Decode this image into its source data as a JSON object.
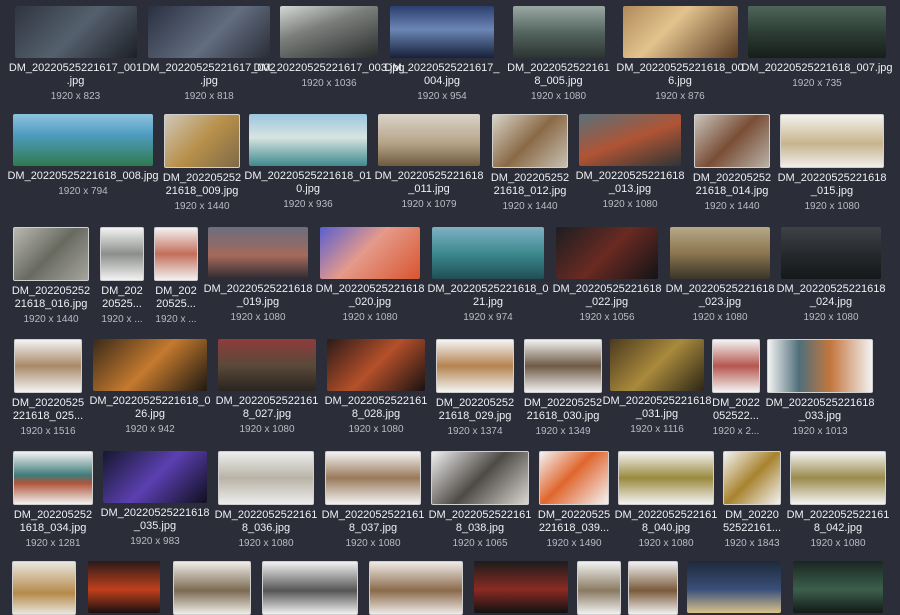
{
  "gallery": {
    "rows": [
      [
        {
          "name": "DM_20220525221617_001\n.jpg",
          "dims": "1920 x 823",
          "bg": "linear-gradient(135deg,#2f3540,#55606e 50%,#1d2026)"
        },
        {
          "name": "DM_20220525221617_002\n.jpg",
          "dims": "1920 x 818",
          "bg": "linear-gradient(135deg,#2a3040,#626d80 55%,#2a2d36)"
        },
        {
          "name": "DM_20220525221617_003.jpg",
          "dims": "1920 x 1036",
          "bg": "linear-gradient(160deg,#d6d8d6,#7a7d7a 40%,#2a2c2c)"
        },
        {
          "name": "DM_20220525221617_\n004.jpg",
          "dims": "1920 x 954",
          "bg": "linear-gradient(180deg,#2c3f6e,#6b86b6 45%,#16203a)"
        },
        {
          "name": "DM_2022052522161\n8_005.jpg",
          "dims": "1920 x 1080",
          "bg": "linear-gradient(180deg,#9aa9a4,#55655f 50%,#2b3431)"
        },
        {
          "name": "DM_20220525221618_00\n6.jpg",
          "dims": "1920 x 876",
          "bg": "linear-gradient(135deg,#b08a5a,#e2c38d 40%,#5a3a22)"
        },
        {
          "name": "DM_20220525221618_007.jpg",
          "dims": "1920 x 735",
          "bg": "linear-gradient(180deg,#4f6559,#2a3a32 55%,#171e1a)"
        }
      ],
      [
        {
          "name": "DM_20220525221618_008.jpg",
          "dims": "1920 x 794",
          "bg": "linear-gradient(180deg,#8ec3de,#4f9cc0 40%,#2f7a4e)"
        },
        {
          "name": "DM_202205252\n21618_009.jpg",
          "dims": "1920 x 1440",
          "bg": "linear-gradient(135deg,#cfc7b9,#b8904a 50%,#7e6a48)"
        },
        {
          "name": "DM_20220525221618_01\n0.jpg",
          "dims": "1920 x 936",
          "bg": "linear-gradient(180deg,#9cc6de,#d7e4e0 45%,#3f8a8e)"
        },
        {
          "name": "DM_20220525221618\n_011.jpg",
          "dims": "1920 x 1079",
          "bg": "linear-gradient(180deg,#d9d4c9,#b7a58a 55%,#6f5a3f)"
        },
        {
          "name": "DM_202205252\n21618_012.jpg",
          "dims": "1920 x 1440",
          "bg": "linear-gradient(135deg,#d7d2c7,#8a6a46 50%,#c7c0b2)"
        },
        {
          "name": "DM_20220525221618\n_013.jpg",
          "dims": "1920 x 1080",
          "bg": "linear-gradient(160deg,#59707a,#b05434 50%,#2d3536)"
        },
        {
          "name": "DM_202205252\n21618_014.jpg",
          "dims": "1920 x 1440",
          "bg": "linear-gradient(135deg,#c8c4bc,#7a4e36 50%,#b9b3a8)"
        },
        {
          "name": "DM_20220525221618\n_015.jpg",
          "dims": "1920 x 1080",
          "bg": "linear-gradient(180deg,#f4f2ee,#c7b48c 55%,#f0eeea)"
        }
      ],
      [
        {
          "name": "DM_202205252\n21618_016.jpg",
          "dims": "1920 x 1440",
          "bg": "linear-gradient(135deg,#b9b8b2,#686a60 50%,#a6a59e)"
        },
        {
          "name": "DM_202\n20525...",
          "dims": "1920 x ...",
          "bg": "linear-gradient(180deg,#f2f2f2,#8b8f8a 50%,#f2f2f2)"
        },
        {
          "name": "DM_202\n20525...",
          "dims": "1920 x ...",
          "bg": "linear-gradient(180deg,#f2f2f2,#c46e5a 50%,#f2f2f2)"
        },
        {
          "name": "DM_20220525221618\n_019.jpg",
          "dims": "1920 x 1080",
          "bg": "linear-gradient(180deg,#6b6e80,#a5695a 55%,#2e2a33)"
        },
        {
          "name": "DM_20220525221618\n_020.jpg",
          "dims": "1920 x 1080",
          "bg": "linear-gradient(135deg,#5a5fd0,#e59a8a 45%,#d8552e)"
        },
        {
          "name": "DM_20220525221618_0\n21.jpg",
          "dims": "1920 x 974",
          "bg": "linear-gradient(180deg,#7fb0c4,#3d8a8f 50%,#1f4f55)"
        },
        {
          "name": "DM_20220525221618\n_022.jpg",
          "dims": "1920 x 1056",
          "bg": "linear-gradient(135deg,#1c1e22,#6a2a22 50%,#121316)"
        },
        {
          "name": "DM_20220525221618\n_023.jpg",
          "dims": "1920 x 1080",
          "bg": "linear-gradient(180deg,#b6a888,#8b7650 50%,#3a3428)"
        },
        {
          "name": "DM_20220525221618\n_024.jpg",
          "dims": "1920 x 1080",
          "bg": "linear-gradient(180deg,#3e4246,#25282b 55%,#15171a)"
        }
      ],
      [
        {
          "name": "DM_20220525\n221618_025...",
          "dims": "1920 x 1516",
          "bg": "linear-gradient(180deg,#f3f3f3,#a98a68 50%,#f3f3f3)"
        },
        {
          "name": "DM_20220525221618_0\n26.jpg",
          "dims": "1920 x 942",
          "bg": "linear-gradient(135deg,#3a2a1a,#c57a2e 50%,#1e1812)"
        },
        {
          "name": "DM_2022052522161\n8_027.jpg",
          "dims": "1920 x 1080",
          "bg": "linear-gradient(180deg,#8e3b3b,#5a4a3a 50%,#2a2420)"
        },
        {
          "name": "DM_2022052522161\n8_028.jpg",
          "dims": "1920 x 1080",
          "bg": "linear-gradient(135deg,#2d1a18,#b5502a 50%,#1a1212)"
        },
        {
          "name": "DM_202205252\n21618_029.jpg",
          "dims": "1920 x 1374",
          "bg": "linear-gradient(180deg,#f4f4f4,#b4834f 50%,#f4f4f4)"
        },
        {
          "name": "DM_202205252\n21618_030.jpg",
          "dims": "1920 x 1349",
          "bg": "linear-gradient(180deg,#f1f1f1,#6f5a45 50%,#f1f1f1)"
        },
        {
          "name": "DM_20220525221618\n_031.jpg",
          "dims": "1920 x 1116",
          "bg": "linear-gradient(135deg,#4c3a1e,#a98a3c 50%,#2d2617)"
        },
        {
          "name": "DM_2022\n052522...",
          "dims": "1920 x 2...",
          "bg": "linear-gradient(180deg,#f3f3f3,#b6564e 50%,#f3f3f3)"
        },
        {
          "name": "DM_20220525221618\n_033.jpg",
          "dims": "1920 x 1013",
          "bg": "linear-gradient(90deg,#f2f2f2,#4f6f7a 30%,#c4763e 60%,#f2f2f2)"
        }
      ],
      [
        {
          "name": "DM_202205252\n1618_034.jpg",
          "dims": "1920 x 1281",
          "bg": "linear-gradient(180deg,#f2f2f2,#3f7a7a 45%,#b0553a 60%,#f2f2f2)"
        },
        {
          "name": "DM_20220525221618\n_035.jpg",
          "dims": "1920 x 983",
          "bg": "linear-gradient(135deg,#15182e,#5c3fb2 50%,#0f1020)"
        },
        {
          "name": "DM_2022052522161\n8_036.jpg",
          "dims": "1920 x 1080",
          "bg": "linear-gradient(180deg,#ededed,#b9b3a6 50%,#ededed)"
        },
        {
          "name": "DM_2022052522161\n8_037.jpg",
          "dims": "1920 x 1080",
          "bg": "linear-gradient(180deg,#f2f2f2,#9a7a5a 50%,#f2f2f2)"
        },
        {
          "name": "DM_2022052522161\n8_038.jpg",
          "dims": "1920 x 1065",
          "bg": "linear-gradient(135deg,#efefef,#4e4a46 50%,#d9d6d0)"
        },
        {
          "name": "DM_20220525\n221618_039...",
          "dims": "1920 x 1490",
          "bg": "linear-gradient(135deg,#f3f3f3,#e0662e 45%,#f3f3f3)"
        },
        {
          "name": "DM_2022052522161\n8_040.jpg",
          "dims": "1920 x 1080",
          "bg": "linear-gradient(180deg,#f3f3f3,#9a8a3e 50%,#f3f3f3)"
        },
        {
          "name": "DM_20220\n52522161...",
          "dims": "1920 x 1843",
          "bg": "linear-gradient(135deg,#f3f3f3,#a8832e 50%,#f3f3f3)"
        },
        {
          "name": "DM_2022052522161\n8_042.jpg",
          "dims": "1920 x 1080",
          "bg": "linear-gradient(180deg,#f3f3f3,#9a8a4a 50%,#f3f3f3)"
        }
      ],
      [
        {
          "name": "",
          "dims": "",
          "bg": "linear-gradient(180deg,#e9e6df,#b58a4a 60%,#e9e6df)"
        },
        {
          "name": "",
          "dims": "",
          "bg": "linear-gradient(180deg,#2a1a1a,#c0401c 55%,#1a1010)"
        },
        {
          "name": "",
          "dims": "",
          "bg": "linear-gradient(180deg,#efece6,#7b6a52 55%,#efece6)"
        },
        {
          "name": "",
          "dims": "",
          "bg": "linear-gradient(180deg,#f1f1f1,#555555 55%,#f1f1f1)"
        },
        {
          "name": "",
          "dims": "",
          "bg": "linear-gradient(180deg,#eeeae6,#8a6a4a 55%,#eeeae6)"
        },
        {
          "name": "",
          "dims": "",
          "bg": "linear-gradient(180deg,#1c1c1c,#8a2a22 55%,#121212)"
        },
        {
          "name": "",
          "dims": "",
          "bg": "linear-gradient(180deg,#f1f1f1,#8a7a62 55%,#f1f1f1)"
        },
        {
          "name": "",
          "dims": "",
          "bg": "linear-gradient(180deg,#f1f1f1,#7a5a3a 55%,#f1f1f1)"
        },
        {
          "name": "",
          "dims": "",
          "bg": "linear-gradient(180deg,#1e2a3a,#3a4f7a 55%,#d8c28a)"
        },
        {
          "name": "",
          "dims": "",
          "bg": "linear-gradient(180deg,#1a2622,#3c5f4c 55%,#121a16)"
        }
      ]
    ]
  }
}
